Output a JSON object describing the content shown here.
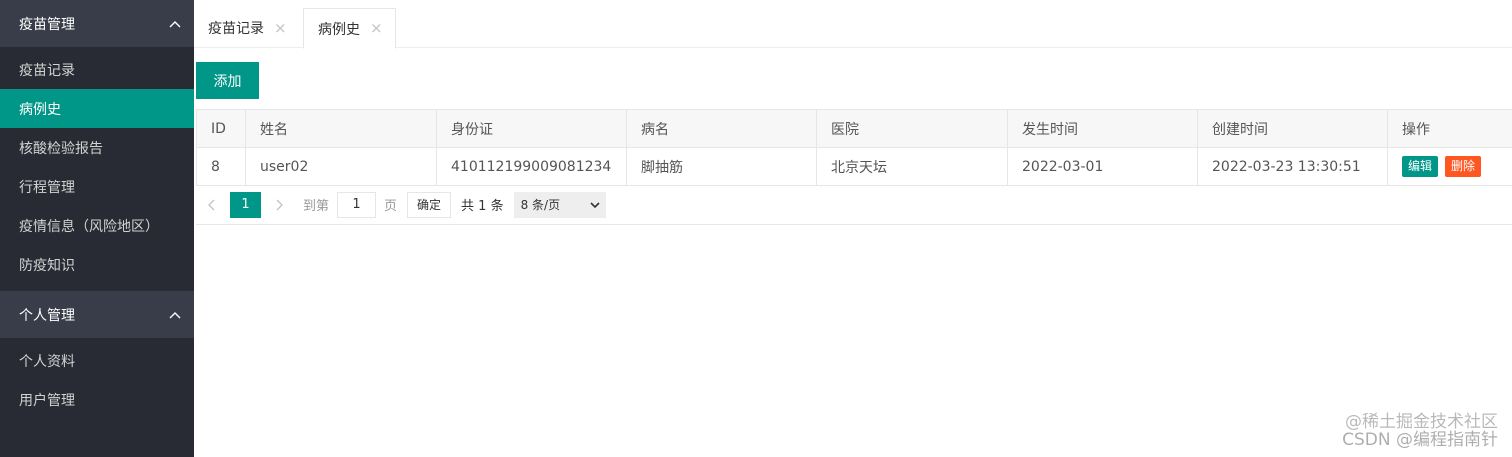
{
  "sidebar": {
    "groups": [
      {
        "title": "疫苗管理",
        "items": [
          {
            "label": "疫苗记录"
          },
          {
            "label": "病例史"
          },
          {
            "label": "核酸检验报告"
          },
          {
            "label": "行程管理"
          },
          {
            "label": "疫情信息（风险地区）"
          },
          {
            "label": "防疫知识"
          }
        ]
      },
      {
        "title": "个人管理",
        "items": [
          {
            "label": "个人资料"
          },
          {
            "label": "用户管理"
          }
        ]
      }
    ],
    "active_item": "病例史"
  },
  "tabs": [
    {
      "label": "疫苗记录",
      "close": "×"
    },
    {
      "label": "病例史",
      "close": "×"
    }
  ],
  "toolbar": {
    "add_label": "添加"
  },
  "table": {
    "headers": [
      "ID",
      "姓名",
      "身份证",
      "病名",
      "医院",
      "发生时间",
      "创建时间",
      "操作"
    ],
    "rows": [
      {
        "id": "8",
        "name": "user02",
        "id_card": "410112199009081234",
        "disease": "脚抽筋",
        "hospital": "北京天坛",
        "occur_time": "2022-03-01",
        "create_time": "2022-03-23 13:30:51",
        "edit": "编辑",
        "delete": "删除"
      }
    ]
  },
  "pagination": {
    "current": "1",
    "goto_label": "到第",
    "goto_value": "1",
    "page_label": "页",
    "confirm": "确定",
    "total": "共 1 条",
    "page_size": "8 条/页"
  },
  "watermark": {
    "line1": "@稀土掘金技术社区",
    "line2": "CSDN @编程指南针"
  },
  "colors": {
    "accent": "#009688",
    "danger": "#ff5722",
    "sidebar_bg": "#282b33",
    "group_bg": "#393d49"
  }
}
